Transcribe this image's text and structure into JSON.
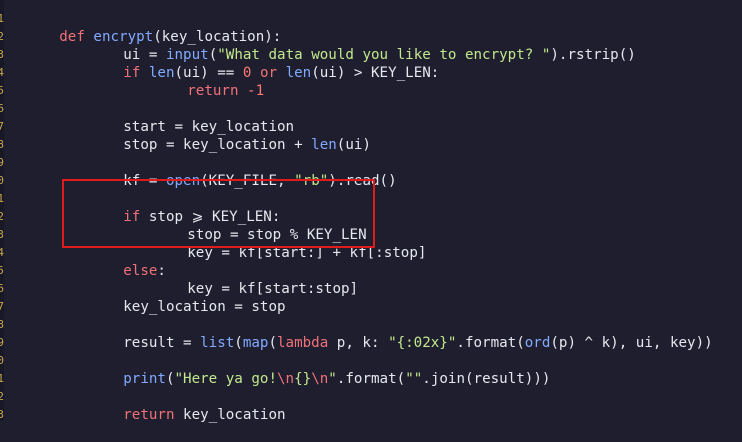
{
  "editor": {
    "gutter_numbers": [
      "1",
      "2",
      "3",
      "4",
      "5",
      "6",
      "7",
      "8",
      "9",
      "0",
      "1",
      "2",
      "3",
      "4",
      "5",
      "6",
      "7",
      "8",
      "9",
      "0",
      "1",
      "2",
      "3"
    ],
    "colors": {
      "background": "#1e1e2e",
      "keyword": "#f07178",
      "function": "#82aaff",
      "string": "#c3e88d",
      "number": "#ff7b72",
      "highlight_box": "#e01b1b"
    },
    "lines": [
      {
        "id": "l1",
        "parts": [
          "def",
          " ",
          "encrypt",
          "(key_location):"
        ]
      },
      {
        "id": "l2",
        "parts": [
          "ui = ",
          "input",
          "(",
          "\"What data would you like to encrypt? \"",
          ").rstrip()"
        ]
      },
      {
        "id": "l3",
        "parts": [
          "if",
          " ",
          "len",
          "(ui) == ",
          "0",
          " ",
          "or",
          " ",
          "len",
          "(ui) > KEY_LEN:"
        ]
      },
      {
        "id": "l4",
        "parts": [
          "return",
          " ",
          "-1"
        ]
      },
      {
        "id": "l5",
        "parts": [
          "start = key_location"
        ]
      },
      {
        "id": "l6",
        "parts": [
          "stop = key_location + ",
          "len",
          "(ui)"
        ]
      },
      {
        "id": "l7",
        "parts": [
          "kf = ",
          "open",
          "(KEY_FILE, ",
          "\"rb\"",
          ").read()"
        ]
      },
      {
        "id": "l8",
        "parts": [
          "if",
          " stop ⩾ KEY_LEN:"
        ]
      },
      {
        "id": "l9",
        "parts": [
          "stop = stop % KEY_LEN"
        ]
      },
      {
        "id": "l10",
        "parts": [
          "key = kf[start:] + kf[:stop]"
        ]
      },
      {
        "id": "l11",
        "parts": [
          "else",
          ":"
        ]
      },
      {
        "id": "l12",
        "parts": [
          "key = kf[start:stop]"
        ]
      },
      {
        "id": "l13",
        "parts": [
          "key_location = stop"
        ]
      },
      {
        "id": "l14",
        "parts": [
          "result = ",
          "list",
          "(",
          "map",
          "(",
          "lambda",
          " p, k: ",
          "\"{:02x}\"",
          ".format(",
          "ord",
          "(p) ^ k), ui, key))"
        ]
      },
      {
        "id": "l15",
        "parts": [
          "print",
          "(",
          "\"Here ya go!",
          "\\n",
          "{}",
          "\\n",
          "\"",
          ".format(",
          "\"\"",
          ".join(result)))"
        ]
      },
      {
        "id": "l16",
        "parts": [
          "return",
          " key_location"
        ]
      }
    ]
  }
}
